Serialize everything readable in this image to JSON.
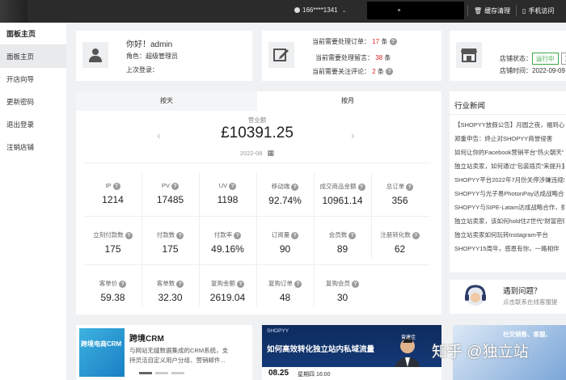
{
  "topbar": {
    "user": "166****1341",
    "cache_label": "缓存清理",
    "mobile_label": "手机访问"
  },
  "sidebar": {
    "title": "面板主页",
    "items": [
      {
        "label": "面板主页"
      },
      {
        "label": "开店向导"
      },
      {
        "label": "更新密码"
      },
      {
        "label": "退出登录"
      },
      {
        "label": "注销店铺"
      }
    ]
  },
  "profile": {
    "greeting": "你好！admin",
    "role_label": "角色：",
    "role": "超级管理员",
    "last_login_label": "上次登录："
  },
  "pending": {
    "orders_label": "当前需要处理订单：",
    "orders_count": "17",
    "messages_label": "当前需要处理留言：",
    "messages_count": "38",
    "reviews_label": "当前需要关注评论：",
    "reviews_count": "2",
    "unit": "条",
    "help": "?"
  },
  "store": {
    "status_label": "店铺状态：",
    "status_running": "运行中",
    "status_other": "正常",
    "time_label": "店铺时间：",
    "time_value": "2022-09-09"
  },
  "stats": {
    "tab_day": "按天",
    "tab_month": "按月",
    "amount_label": "营业额",
    "amount": "£10391.25",
    "month": "2022-08",
    "help": "?",
    "items": [
      {
        "label": "IP",
        "value": "1214"
      },
      {
        "label": "PV",
        "value": "17485"
      },
      {
        "label": "UV",
        "value": "1198"
      },
      {
        "label": "移动端",
        "value": "92.74%"
      },
      {
        "label": "成交商品金额",
        "value": "10961.14"
      },
      {
        "label": "总订单",
        "value": "356"
      },
      {
        "label": "立刻付款数",
        "value": "175"
      },
      {
        "label": "付款数",
        "value": "175"
      },
      {
        "label": "付款率",
        "value": "49.16%"
      },
      {
        "label": "订阅量",
        "value": "90"
      },
      {
        "label": "会员数",
        "value": "89"
      },
      {
        "label": "注册转化数",
        "value": "62"
      },
      {
        "label": "客单价",
        "value": "59.38"
      },
      {
        "label": "客单数",
        "value": "32.30"
      },
      {
        "label": "复购金额",
        "value": "2619.04"
      },
      {
        "label": "复购订单",
        "value": "48"
      },
      {
        "label": "复购会员",
        "value": "30"
      }
    ]
  },
  "news": {
    "title": "行业新闻",
    "items": [
      "【SHOPYY放假公告】月圆之夜，福到心到",
      "郑重申告：终止对SHOPYY商誉侵害",
      "如何让你的Facebook营销平台“热火朝天”",
      "独立站卖家，如何通过“包装插页”来提升复",
      "SHOPYY平台2022年7月份关停涉嫌违规站",
      "SHOPYY与光子易PhotonPay达成战略合作",
      "SHOPYY与SIPE-Latam达成战略合作，携",
      "独立站卖家，该如何hold住Z世代“财富密码",
      "独立站卖家如何玩转Instagram平台",
      "SHOPYY15周年，感恩有你，一路相伴"
    ]
  },
  "qa": {
    "title": "遇到问题？",
    "subtitle": "点击联系在线客服提"
  },
  "crm": {
    "banner_text": "跨境电商CRM",
    "title": "跨境CRM",
    "desc_line1": "与网站无缝数据集成的CRM系统，支",
    "desc_line2": "持灵活自定义用户分组、营销邮件..."
  },
  "promo": {
    "brand": "SHOPYY",
    "headline": "如何高效转化独立站内私域流量",
    "date": "08.25",
    "time_text": "星期四 16:00",
    "speaker": "曾建佳"
  },
  "watermark": "知乎 @独立站",
  "promo2": {
    "text": "社交销售、客服、"
  }
}
